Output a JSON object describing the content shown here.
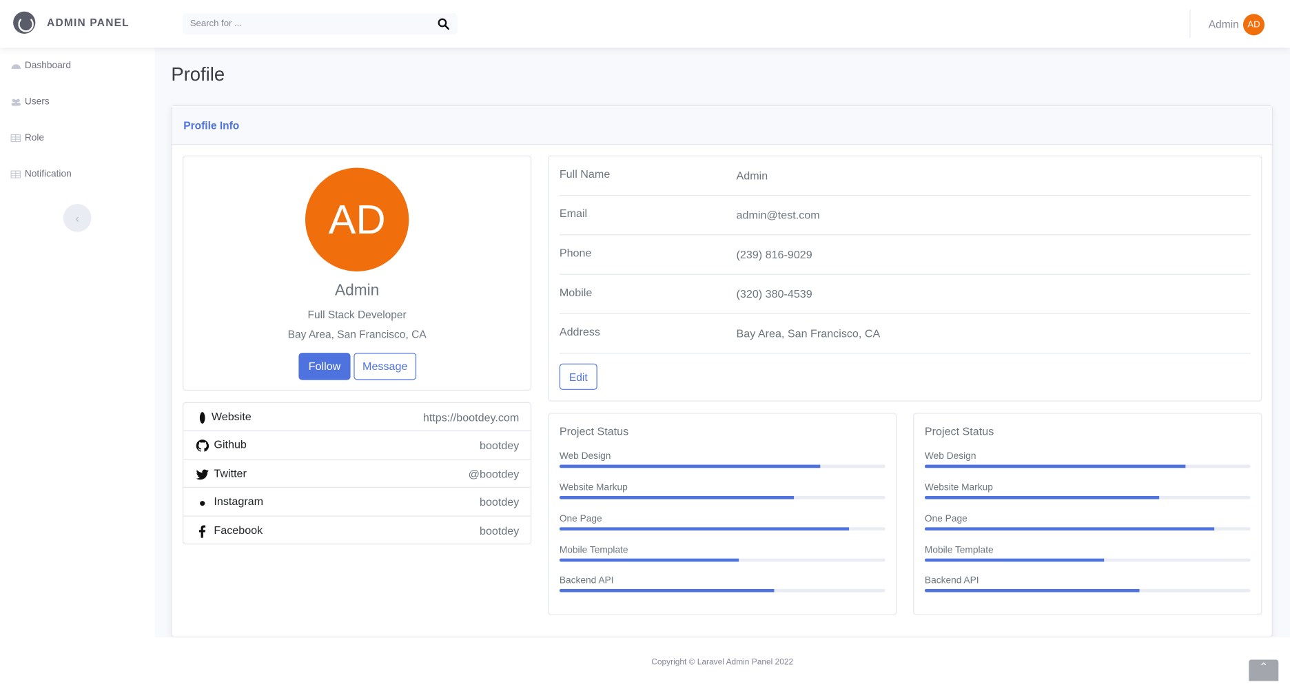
{
  "brand": {
    "title": "ADMIN PANEL"
  },
  "search": {
    "placeholder": "Search for ..."
  },
  "user": {
    "name": "Admin",
    "initials": "AD"
  },
  "sidebar": {
    "items": [
      {
        "label": "Dashboard",
        "icon": "gauge-icon"
      },
      {
        "label": "Users",
        "icon": "users-icon"
      },
      {
        "label": "Role",
        "icon": "table-icon"
      },
      {
        "label": "Notification",
        "icon": "table-icon"
      }
    ]
  },
  "page": {
    "title": "Profile",
    "card_title": "Profile Info"
  },
  "profile": {
    "initials": "AD",
    "name": "Admin",
    "role": "Full Stack Developer",
    "location": "Bay Area, San Francisco, CA",
    "follow_label": "Follow",
    "message_label": "Message"
  },
  "social": [
    {
      "label": "Website",
      "value": "https://bootdey.com",
      "icon": "globe-icon"
    },
    {
      "label": "Github",
      "value": "bootdey",
      "icon": "github-icon"
    },
    {
      "label": "Twitter",
      "value": "@bootdey",
      "icon": "twitter-icon"
    },
    {
      "label": "Instagram",
      "value": "bootdey",
      "icon": "instagram-icon"
    },
    {
      "label": "Facebook",
      "value": "bootdey",
      "icon": "facebook-icon"
    }
  ],
  "info": {
    "rows": [
      {
        "label": "Full Name",
        "value": "Admin"
      },
      {
        "label": "Email",
        "value": "admin@test.com"
      },
      {
        "label": "Phone",
        "value": "(239) 816-9029"
      },
      {
        "label": "Mobile",
        "value": "(320) 380-4539"
      },
      {
        "label": "Address",
        "value": "Bay Area, San Francisco, CA"
      }
    ],
    "edit_label": "Edit"
  },
  "projects": [
    {
      "title": "Project Status",
      "items": [
        {
          "label": "Web Design",
          "progress": 80
        },
        {
          "label": "Website Markup",
          "progress": 72
        },
        {
          "label": "One Page",
          "progress": 89
        },
        {
          "label": "Mobile Template",
          "progress": 55
        },
        {
          "label": "Backend API",
          "progress": 66
        }
      ]
    },
    {
      "title": "Project Status",
      "items": [
        {
          "label": "Web Design",
          "progress": 80
        },
        {
          "label": "Website Markup",
          "progress": 72
        },
        {
          "label": "One Page",
          "progress": 89
        },
        {
          "label": "Mobile Template",
          "progress": 55
        },
        {
          "label": "Backend API",
          "progress": 66
        }
      ]
    }
  ],
  "footer": {
    "copyright": "Copyright © Laravel Admin Panel 2022"
  },
  "colors": {
    "primary": "#4e73df",
    "avatar": "#f06e0c",
    "background": "#f8f9fc"
  }
}
